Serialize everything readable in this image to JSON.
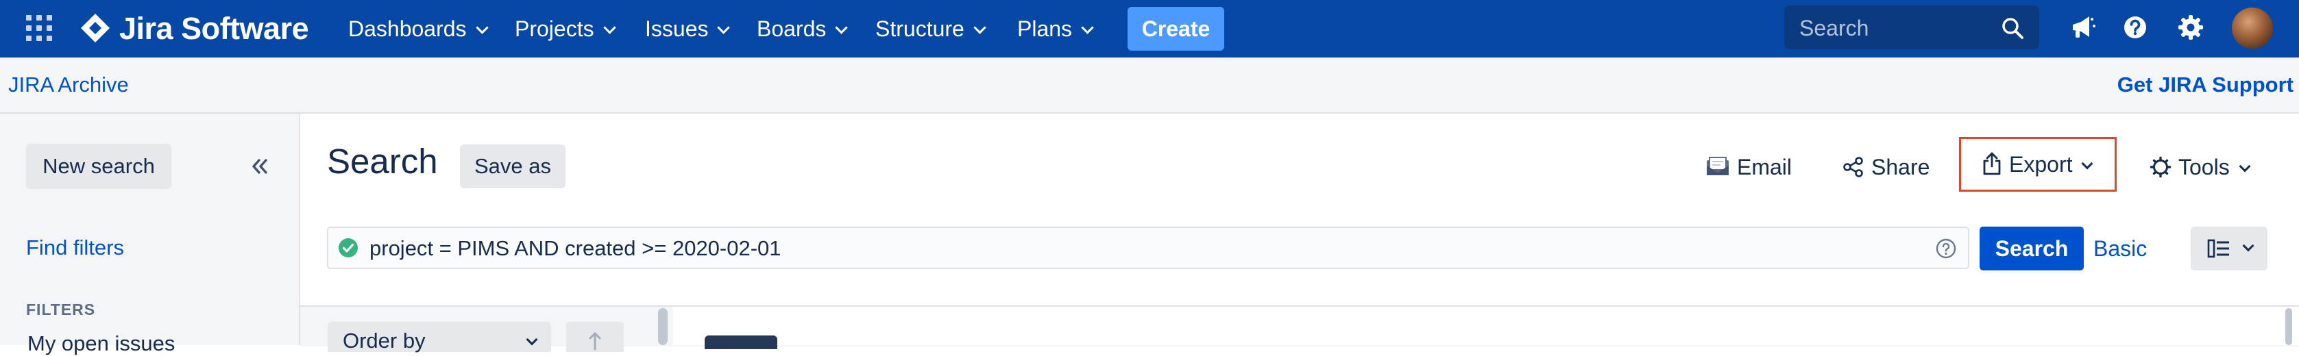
{
  "topnav": {
    "product_name": "Jira Software",
    "menu": [
      {
        "label": "Dashboards"
      },
      {
        "label": "Projects"
      },
      {
        "label": "Issues"
      },
      {
        "label": "Boards"
      },
      {
        "label": "Structure"
      },
      {
        "label": "Plans"
      }
    ],
    "create_label": "Create",
    "search_placeholder": "Search",
    "icons": [
      "app-switcher-icon",
      "megaphone-icon",
      "help-icon",
      "gear-icon",
      "user-avatar"
    ],
    "brand_color": "#0747a6",
    "create_color": "#4c9aff"
  },
  "archive_bar": {
    "title": "JIRA Archive",
    "support_link": "Get JIRA Support"
  },
  "sidebar": {
    "new_search_label": "New search",
    "find_filters_label": "Find filters",
    "filters_heading": "FILTERS",
    "filters": [
      {
        "label": "My open issues"
      }
    ]
  },
  "main": {
    "title": "Search",
    "save_as_label": "Save as",
    "actions": {
      "email": "Email",
      "share": "Share",
      "export": "Export",
      "tools": "Tools"
    },
    "jql_query": "project = PIMS AND created >= 2020-02-01",
    "jql_valid": true,
    "search_button": "Search",
    "basic_link": "Basic",
    "order_by_label": "Order by",
    "highlight_color": "#e0452a",
    "primary_button_color": "#0052cc"
  }
}
